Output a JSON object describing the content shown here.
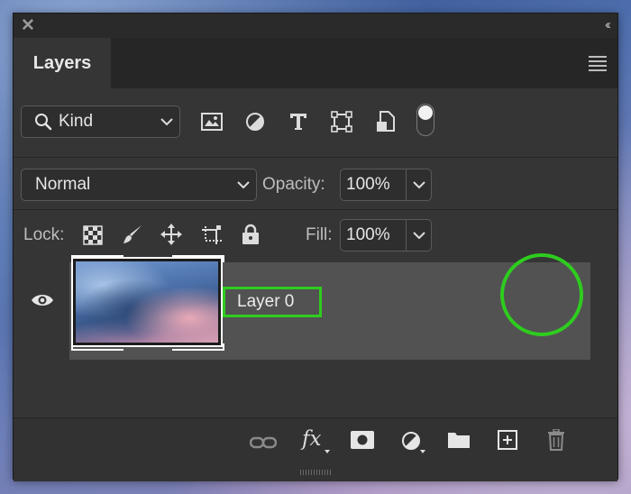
{
  "panel": {
    "close_glyph": "✕",
    "collapse_glyph": "‹‹",
    "tab_label": "Layers"
  },
  "filter": {
    "kind_label": "Kind",
    "icons": [
      "image-filter-icon",
      "adjustment-filter-icon",
      "type-filter-icon",
      "shape-filter-icon",
      "smart-object-filter-icon",
      "filter-toggle-switch"
    ]
  },
  "blend": {
    "mode": "Normal",
    "opacity_label": "Opacity:",
    "opacity_value": "100%"
  },
  "lock": {
    "label": "Lock:",
    "icons": [
      "lock-transparent-pixels-icon",
      "lock-image-pixels-icon",
      "lock-position-icon",
      "lock-artboard-icon",
      "lock-all-icon"
    ],
    "fill_label": "Fill:",
    "fill_value": "100%"
  },
  "layers": [
    {
      "name": "Layer 0",
      "visible": true
    }
  ],
  "footer": {
    "fx_label": "fx",
    "icons": [
      "link-layers-icon",
      "fx-icon",
      "layer-mask-icon",
      "adjustment-layer-icon",
      "new-group-icon",
      "new-layer-icon",
      "delete-layer-icon"
    ]
  },
  "colors": {
    "highlight": "#2ecc1f",
    "panel": "#353535",
    "selected_row": "#525252"
  }
}
